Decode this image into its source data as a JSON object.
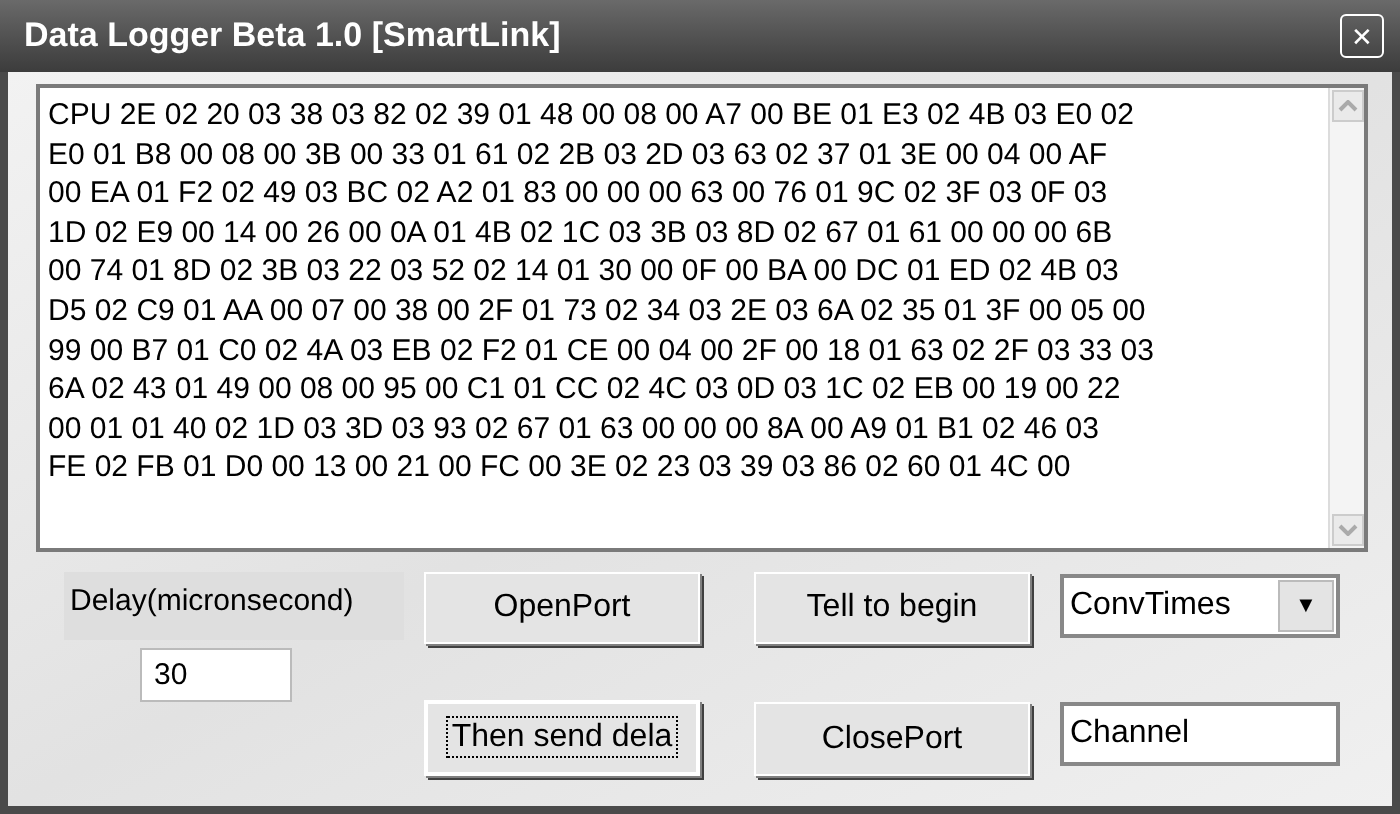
{
  "window": {
    "title": "Data Logger Beta 1.0 [SmartLink]",
    "close": "✕"
  },
  "log_lines": [
    "CPU 2E 02 20 03 38 03 82 02 39 01 48 00 08 00 A7 00 BE 01 E3 02 4B 03 E0 02",
    "E0 01 B8 00 08 00 3B 00 33 01 61 02 2B 03 2D 03 63 02 37 01 3E 00 04 00 AF",
    "00 EA 01 F2 02 49 03 BC 02 A2 01 83 00 00 00 63 00 76 01 9C 02 3F 03 0F 03",
    "1D 02 E9 00 14 00 26 00 0A 01 4B 02 1C 03 3B 03 8D 02 67 01 61 00 00 00 6B",
    "00 74 01 8D 02 3B 03 22 03 52 02 14 01 30 00 0F 00 BA 00 DC 01 ED 02 4B 03",
    "D5 02 C9 01 AA 00 07 00 38 00 2F 01 73 02 34 03 2E 03 6A 02 35 01 3F 00 05 00",
    "99 00 B7 01 C0 02 4A 03 EB 02 F2 01 CE 00 04 00 2F 00 18 01 63 02 2F 03 33 03",
    "6A 02 43 01 49 00 08 00 95 00 C1 01 CC 02 4C 03 0D 03 1C 02 EB 00 19 00 22",
    "00 01 01 40 02 1D 03 3D 03 93 02 67 01 63 00 00 00 8A 00 A9 01 B1 02 46 03",
    "FE 02 FB 01 D0 00 13 00 21 00 FC 00 3E 02 23 03 39 03 86 02 60 01 4C 00"
  ],
  "delay": {
    "label": "Delay(micronsecond)",
    "value": "30"
  },
  "buttons": [
    {
      "label": "OpenPort",
      "focused": false
    },
    {
      "label": "Tell to begin",
      "focused": false
    },
    {
      "label": "Then send dela",
      "focused": true
    },
    {
      "label": "ClosePort",
      "focused": false
    }
  ],
  "conv_dropdown": {
    "value": "ConvTimes",
    "arrow": "▼"
  },
  "channel_field": {
    "value": "Channel"
  }
}
